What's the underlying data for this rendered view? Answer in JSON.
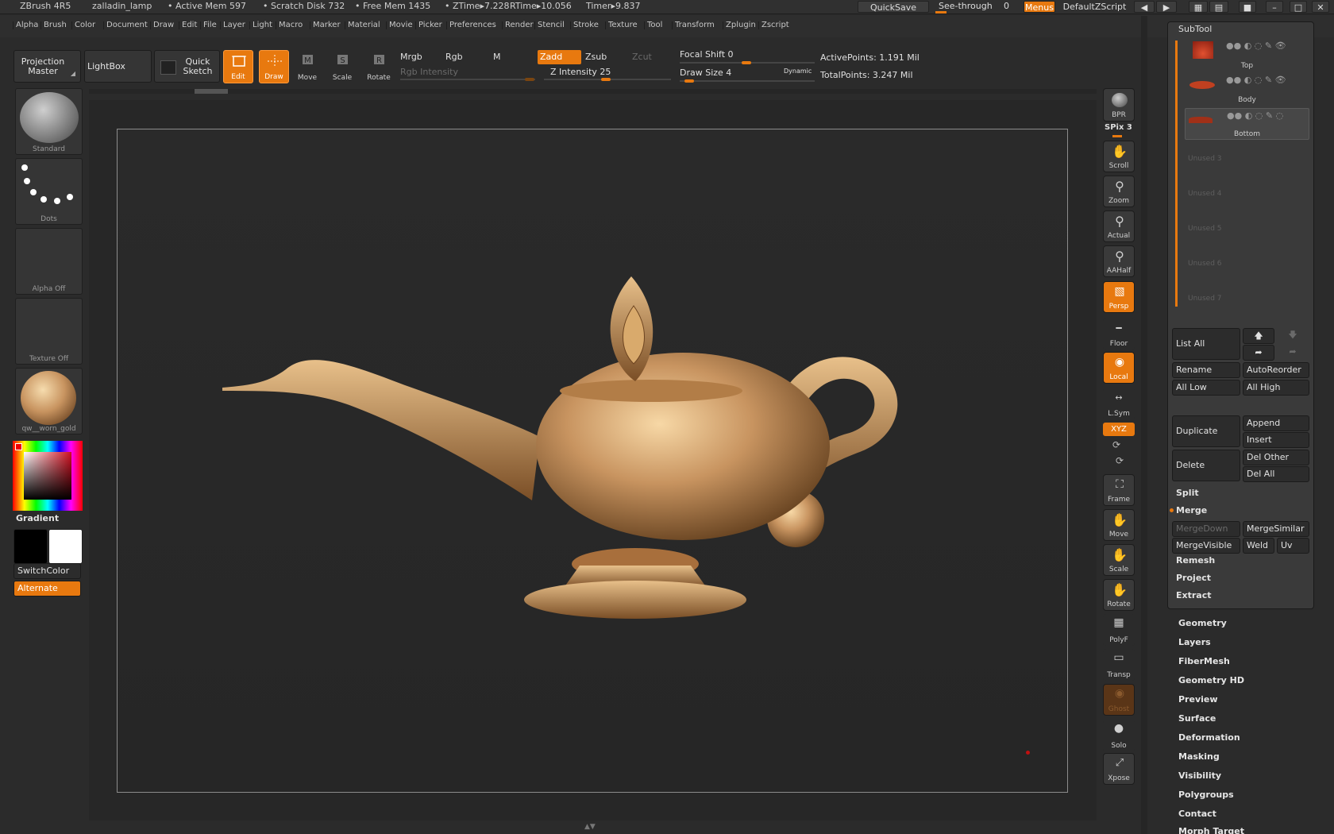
{
  "titlebar": {
    "app": "ZBrush 4R5",
    "document": "zalladin_lamp",
    "active_mem": "• Active Mem 597",
    "scratch_disk": "• Scratch Disk 732",
    "free_mem": "• Free Mem 1435",
    "ztime": "• ZTime▸7.228",
    "rtime": "RTime▸10.056",
    "timer": "Timer▸9.837",
    "quicksave": "QuickSave",
    "see_through": "See-through",
    "see_through_value": "0",
    "menus": "Menus",
    "default_zscript": "DefaultZScript"
  },
  "menubar": [
    "Alpha",
    "Brush",
    "Color",
    "Document",
    "Draw",
    "Edit",
    "File",
    "Layer",
    "Light",
    "Macro",
    "Marker",
    "Material",
    "Movie",
    "Picker",
    "Preferences",
    "Render",
    "Stencil",
    "Stroke",
    "Texture",
    "Tool",
    "Transform",
    "Zplugin",
    "Zscript"
  ],
  "toolbar": {
    "projection_master": "Projection Master",
    "lightbox": "LightBox",
    "quick_sketch": "Quick Sketch",
    "edit": "Edit",
    "draw": "Draw",
    "move": "Move",
    "scale": "Scale",
    "rotate": "Rotate",
    "mrgb": "Mrgb",
    "rgb": "Rgb",
    "m": "M",
    "zadd": "Zadd",
    "zsub": "Zsub",
    "zcut": "Zcut",
    "rgb_intensity": "Rgb Intensity",
    "z_intensity": "Z Intensity 25",
    "focal_shift": "Focal Shift 0",
    "draw_size": "Draw Size 4",
    "dynamic": "Dynamic",
    "active_points": "ActivePoints: 1.191  Mil",
    "total_points": "TotalPoints: 3.247  Mil"
  },
  "left_shelf": {
    "brush": "Standard",
    "stroke": "Dots",
    "alpha": "Alpha  Off",
    "texture": "Texture  Off",
    "material": "qw__worn_gold",
    "gradient": "Gradient",
    "switch_color": "SwitchColor",
    "alternate": "Alternate"
  },
  "right_shelf": {
    "bpr": "BPR",
    "spix": "SPix 3",
    "scroll": "Scroll",
    "zoom": "Zoom",
    "actual": "Actual",
    "aahalf": "AAHalf",
    "persp": "Persp",
    "floor": "Floor",
    "local": "Local",
    "lsym": "L.Sym",
    "xyz": "XYZ",
    "frame": "Frame",
    "move": "Move",
    "scale": "Scale",
    "rotate": "Rotate",
    "polyf": "PolyF",
    "transp": "Transp",
    "ghost": "Ghost",
    "solo": "Solo",
    "xpose": "Xpose"
  },
  "subtool": {
    "title": "SubTool",
    "items": [
      "Top",
      "Body",
      "Bottom"
    ],
    "unused": [
      "Unused  3",
      "Unused  4",
      "Unused  5",
      "Unused  6",
      "Unused  7"
    ],
    "list_all": "List  All",
    "rename": "Rename",
    "autoreorder": "AutoReorder",
    "all_low": "All  Low",
    "all_high": "All  High",
    "duplicate": "Duplicate",
    "append": "Append",
    "insert": "Insert",
    "delete": "Delete",
    "del_other": "Del  Other",
    "del_all": "Del  All",
    "split": "Split",
    "merge": "Merge",
    "mergedown": "MergeDown",
    "mergesimilar": "MergeSimilar",
    "mergevisible": "MergeVisible",
    "weld": "Weld",
    "uv": "Uv",
    "remesh": "Remesh",
    "project": "Project",
    "extract": "Extract"
  },
  "tool_sections": [
    "Geometry",
    "Layers",
    "FiberMesh",
    "Geometry HD",
    "Preview",
    "Surface",
    "Deformation",
    "Masking",
    "Visibility",
    "Polygroups",
    "Contact",
    "Morph Target"
  ],
  "colors": {
    "accent": "#e8790f",
    "gold": "#c89460"
  }
}
